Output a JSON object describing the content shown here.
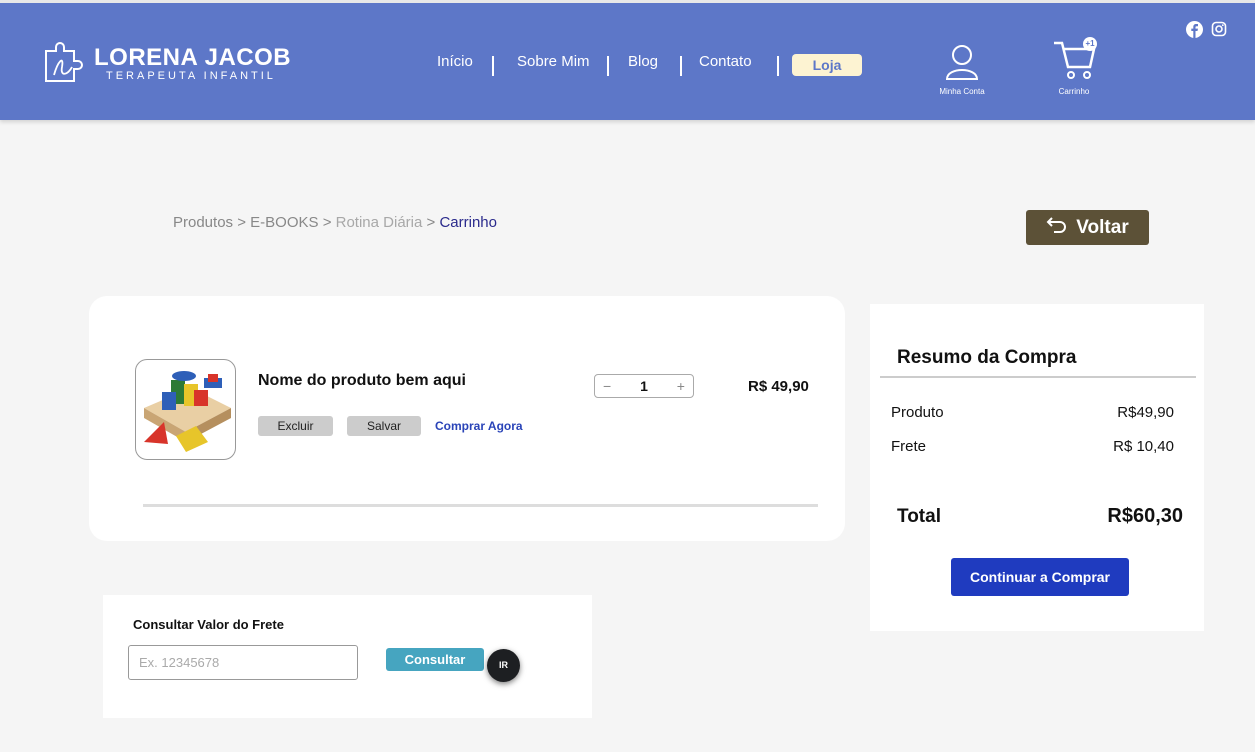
{
  "header": {
    "brand_name": "LORENA JACOB",
    "brand_tagline": "TERAPEUTA INFANTIL",
    "nav": {
      "home": "Início",
      "about": "Sobre Mim",
      "blog": "Blog",
      "contact": "Contato",
      "shop": "Loja"
    },
    "account_label": "Minha Conta",
    "cart_label": "Carrinho",
    "cart_badge": "+1",
    "social_icons": [
      "facebook-icon",
      "instagram-icon"
    ]
  },
  "breadcrumb": {
    "products": "Produtos",
    "ebooks": "E-BOOKS",
    "routine": "Rotina Diária",
    "cart": "Carrinho",
    "separator": ">"
  },
  "back_label": "Voltar",
  "cart_item": {
    "name": "Nome do produto bem aqui",
    "delete_label": "Excluir",
    "save_label": "Salvar",
    "buy_now_label": "Comprar Agora",
    "quantity": "1",
    "minus": "−",
    "plus": "+",
    "price": "R$ 49,90"
  },
  "summary": {
    "title": "Resumo da Compra",
    "product_label": "Produto",
    "product_value": "R$49,90",
    "shipping_label": "Frete",
    "shipping_value": "R$ 10,40",
    "total_label": "Total",
    "total_value": "R$60,30",
    "continue_label": "Continuar a Comprar"
  },
  "shipping_check": {
    "title": "Consultar  Valor do Frete",
    "placeholder": "Ex. 12345678",
    "button_label": "Consultar",
    "badge_text": "IR"
  },
  "colors": {
    "header_bg": "#5d77c8",
    "shop_bg": "#fdf3d2",
    "back_btn": "#5c5137",
    "continue_btn": "#1f3bbf",
    "consult_btn": "#46a5c0"
  }
}
